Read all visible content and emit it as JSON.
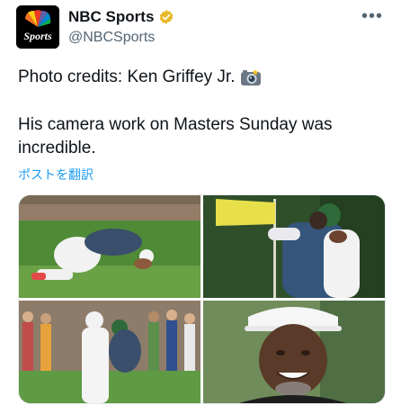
{
  "account": {
    "display_name": "NBC Sports",
    "handle": "@NBCSports",
    "avatar_text": "Sports",
    "verified": true
  },
  "tweet": {
    "line1": "Photo credits: Ken Griffey Jr.",
    "line2": "His camera work on Masters Sunday was incredible.",
    "translate_label": "ポストを翻訳"
  },
  "menu": {
    "more_label": "•••"
  },
  "icons": {
    "verified": "verified-badge-icon",
    "camera": "camera-icon",
    "more": "more-options-icon"
  },
  "colors": {
    "link": "#1d9bf0",
    "verified_gold": "#e8b829",
    "text": "#0f1419",
    "secondary": "#536471"
  }
}
